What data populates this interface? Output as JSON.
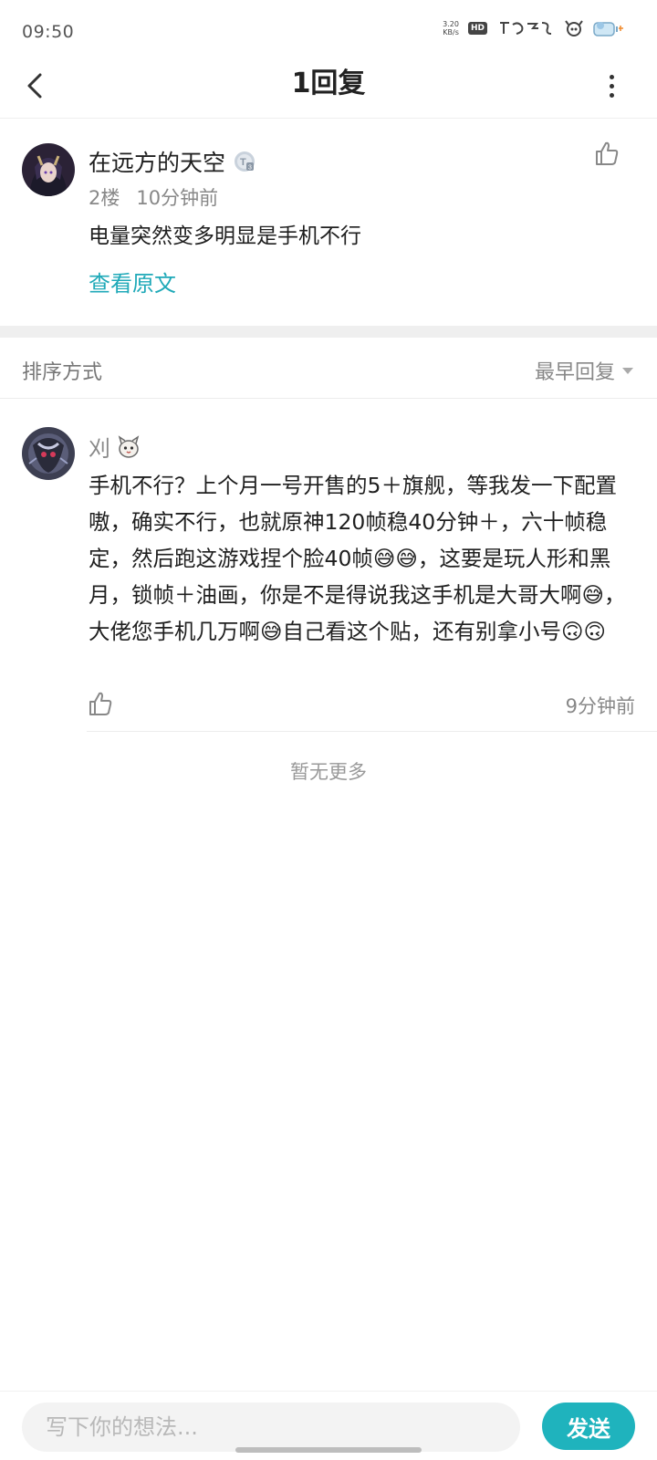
{
  "status_bar": {
    "time": "09:50",
    "net_speed_value": "3.20",
    "net_speed_unit": "KB/s",
    "hd": "HD",
    "icons": [
      "network-speed-icon",
      "hd-icon",
      "brand-logo-icon",
      "app-mascot-icon",
      "battery-mascot-icon"
    ]
  },
  "header": {
    "title": "1回复",
    "back_icon": "chevron-left-icon",
    "more_icon": "more-vertical-icon"
  },
  "original_comment": {
    "username": "在远方的天空",
    "level_badge": "T3",
    "floor": "2楼",
    "time": "10分钟前",
    "text": "电量突然变多明显是手机不行",
    "view_original": "查看原文"
  },
  "sort": {
    "label": "排序方式",
    "selected": "最早回复"
  },
  "reply": {
    "username": "刈",
    "text": "手机不行？上个月一号开售的5＋旗舰，等我发一下配置嗷，确实不行，也就原神120帧稳40分钟＋，六十帧稳定，然后跑这游戏捏个脸40帧😅😅，这要是玩人形和黑月，锁帧＋油画，你是不是得说我这手机是大哥大啊😅，大佬您手机几万啊😅自己看这个贴，还有别拿小号🙃🙃",
    "time": "9分钟前"
  },
  "footer": {
    "no_more": "暂无更多"
  },
  "input": {
    "placeholder": "写下你的想法...",
    "value": "",
    "send_label": "发送"
  },
  "colors": {
    "accent": "#1fb3bd",
    "link": "#1fa9b8",
    "secondary_text": "#888888"
  }
}
